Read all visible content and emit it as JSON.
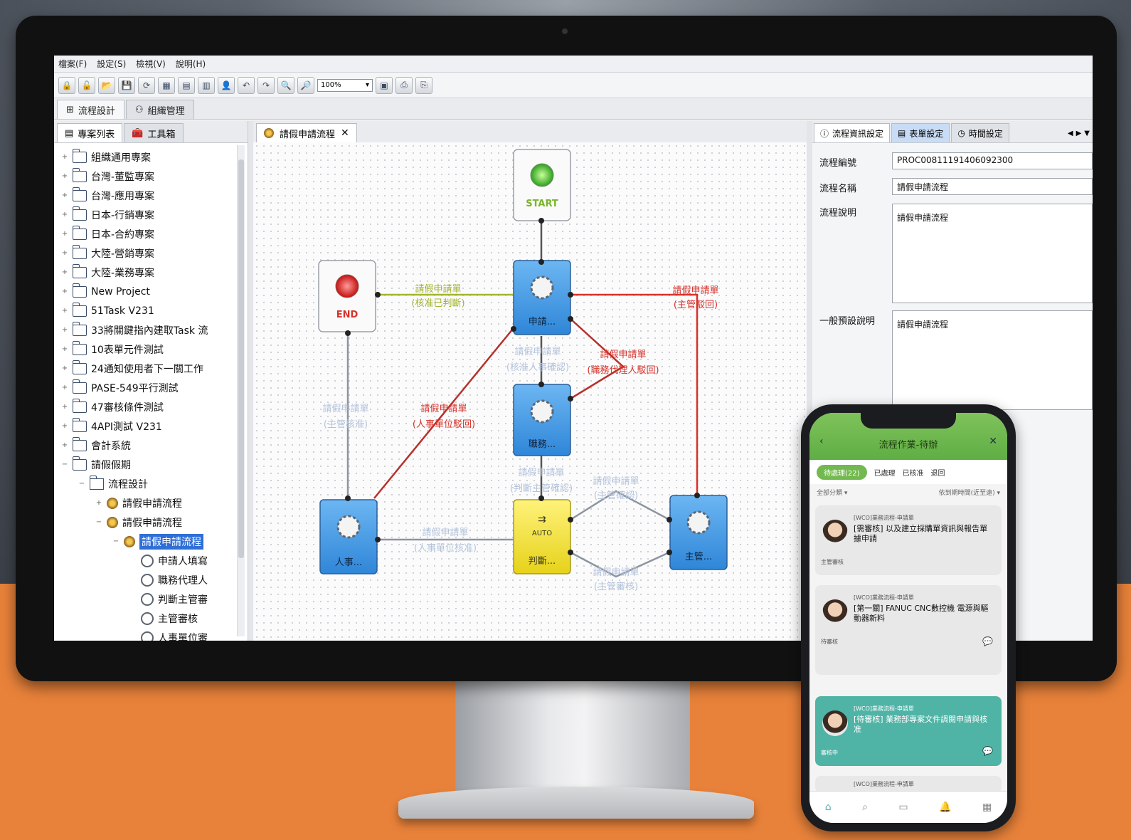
{
  "app": {
    "menu": [
      "檔案(F)",
      "設定(S)",
      "檢視(V)",
      "說明(H)"
    ],
    "zoom": "100%",
    "main_tabs": [
      "流程設計",
      "組織管理"
    ]
  },
  "left_panel": {
    "tabs": [
      "專案列表",
      "工具箱"
    ],
    "tree": [
      {
        "label": "組織通用專案",
        "level": 0,
        "type": "folder",
        "expander": "+"
      },
      {
        "label": "台灣-董監專案",
        "level": 0,
        "type": "folder",
        "expander": "+"
      },
      {
        "label": "台灣-應用專案",
        "level": 0,
        "type": "folder",
        "expander": "+"
      },
      {
        "label": "日本-行銷專案",
        "level": 0,
        "type": "folder",
        "expander": "+"
      },
      {
        "label": "日本-合約專案",
        "level": 0,
        "type": "folder",
        "expander": "+"
      },
      {
        "label": "大陸-營銷專案",
        "level": 0,
        "type": "folder",
        "expander": "+"
      },
      {
        "label": "大陸-業務專案",
        "level": 0,
        "type": "folder",
        "expander": "+"
      },
      {
        "label": "New Project",
        "level": 0,
        "type": "folder",
        "expander": "+"
      },
      {
        "label": "51Task V231",
        "level": 0,
        "type": "folder",
        "expander": "+"
      },
      {
        "label": "33將關鍵指內建取Task 流",
        "level": 0,
        "type": "folder",
        "expander": "+"
      },
      {
        "label": "10表單元件測試",
        "level": 0,
        "type": "folder",
        "expander": "+"
      },
      {
        "label": "24通知使用者下一關工作",
        "level": 0,
        "type": "folder",
        "expander": "+"
      },
      {
        "label": "PASE-549平行測試",
        "level": 0,
        "type": "folder",
        "expander": "+"
      },
      {
        "label": "47審核條件測試",
        "level": 0,
        "type": "folder",
        "expander": "+"
      },
      {
        "label": "4API測試 V231",
        "level": 0,
        "type": "folder",
        "expander": "+"
      },
      {
        "label": "會計系統",
        "level": 0,
        "type": "folder",
        "expander": "+"
      },
      {
        "label": "請假假期",
        "level": 0,
        "type": "folder",
        "expander": "−"
      },
      {
        "label": "流程設計",
        "level": 1,
        "type": "design",
        "expander": "−"
      },
      {
        "label": "請假申請流程",
        "level": 2,
        "type": "process",
        "expander": "+"
      },
      {
        "label": "請假申請流程",
        "level": 2,
        "type": "process",
        "expander": "−"
      },
      {
        "label": "請假申請流程",
        "level": 3,
        "type": "process",
        "expander": "−",
        "selected": true
      },
      {
        "label": "申請人填寫",
        "level": 4,
        "type": "node",
        "expander": ""
      },
      {
        "label": "職務代理人",
        "level": 4,
        "type": "node",
        "expander": ""
      },
      {
        "label": "判斷主管審",
        "level": 4,
        "type": "node",
        "expander": ""
      },
      {
        "label": "主管審核",
        "level": 4,
        "type": "node",
        "expander": ""
      },
      {
        "label": "人事單位審",
        "level": 4,
        "type": "node",
        "expander": ""
      }
    ]
  },
  "canvas": {
    "tab_label": "請假申請流程",
    "nodes": {
      "start": "START",
      "end": "END",
      "apply": "申請...",
      "agent": "職務...",
      "hr": "人事...",
      "auto": "AUTO",
      "judge": "判斷...",
      "manager": "主管..."
    },
    "edge_labels": {
      "e1_l1": "請假申請單",
      "e1_l2": "(核准已判斷)",
      "e2_l1": "請假申請單",
      "e2_l2": "(主管駁回)",
      "e3_l1": "請假申請單",
      "e3_l2": "(職務代理人駁回)",
      "e4_l1": "請假申請單",
      "e4_l2": "(人事單位駁回)",
      "e5_l1": "請假申請單",
      "e5_l2": "(核准人事確認)",
      "e6_l1": "請假申請單",
      "e6_l2": "(主管核准)",
      "e7_l1": "請假申請單",
      "e7_l2": "(判斷主管確認)",
      "e8_l1": "請假申請單",
      "e8_l2": "(主管確認)",
      "e9_l1": "請假申請單",
      "e9_l2": "(主管審核)",
      "e10_l1": "請假申請單",
      "e10_l2": "(人事單位核准)"
    },
    "colors": {
      "green": "#a3b52e",
      "red": "#d7322a",
      "gray": "#8c94a0",
      "blue_node": "#3f97e4",
      "yellow_node": "#f2e43a"
    }
  },
  "right_panel": {
    "tabs": [
      "流程資訊設定",
      "表單設定",
      "時間設定"
    ],
    "fields": [
      {
        "label": "流程編號",
        "value": "PROC00811191406092300"
      },
      {
        "label": "流程名稱",
        "value": "請假申請流程"
      },
      {
        "label": "流程說明",
        "value": "請假申請流程"
      },
      {
        "label": "一般預設說明",
        "value": "請假申請流程"
      }
    ]
  },
  "phone": {
    "title": "流程作業-待辦",
    "filter_chip": "待處理(22)",
    "tabs": [
      "已處理",
      "已核准",
      "退回"
    ],
    "sub_left": "全部分類 ▾",
    "sub_right": "依到期時間(近至遠) ▾",
    "cards": [
      {
        "meta": "[WCO]業務流程-申請單",
        "title": "[需審核] 以及建立採購單資訊與報告單據申請",
        "foot": "主管審核"
      },
      {
        "meta": "[WCO]業務流程-申請單",
        "title": "[第一關] FANUC CNC數控機 電源與驅動器新料",
        "foot": "待審核"
      },
      {
        "meta": "[WCO]業務流程-申請單",
        "title": "[待審核] 業務部專案文件調閱申請與核准",
        "foot": "審核中"
      },
      {
        "meta": "[WCO]業務流程-申請單",
        "title": "",
        "foot": ""
      }
    ]
  }
}
